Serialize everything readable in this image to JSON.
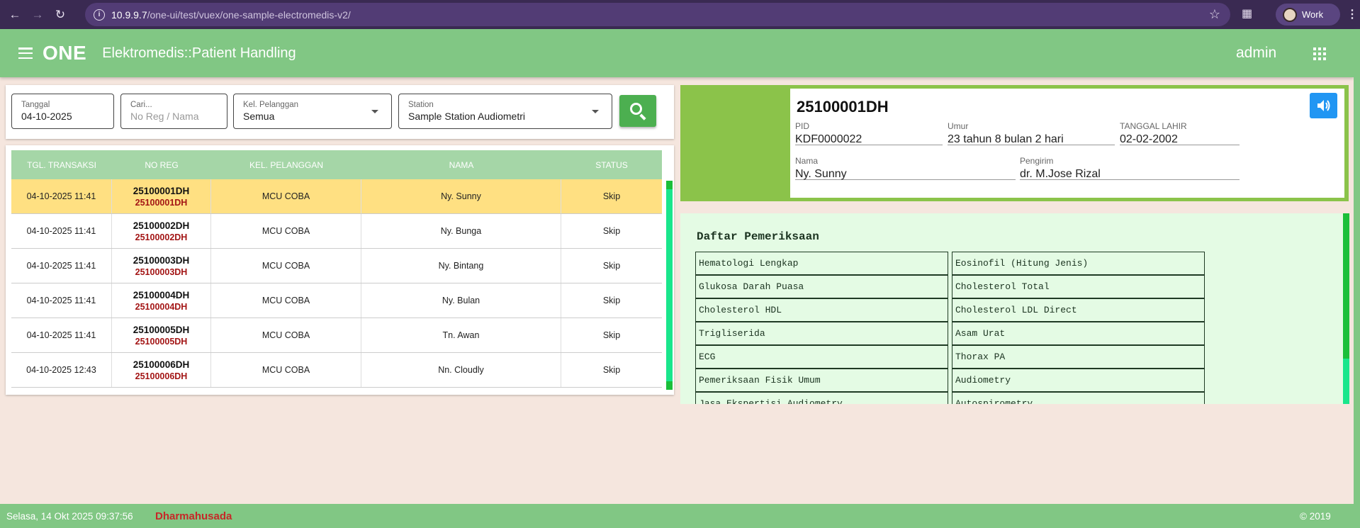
{
  "browser": {
    "url_host": "10.9.9.7",
    "url_path": "/one-ui/test/vuex/one-sample-electromedis-v2/",
    "profile_label": "Work"
  },
  "header": {
    "brand": "ONE",
    "title": "Elektromedis::Patient Handling",
    "user": "admin"
  },
  "filters": {
    "tanggal": {
      "label": "Tanggal",
      "value": "04-10-2025"
    },
    "cari": {
      "label": "Cari...",
      "placeholder": "No Reg / Nama"
    },
    "kel_pelanggan": {
      "label": "Kel. Pelanggan",
      "value": "Semua"
    },
    "station": {
      "label": "Station",
      "value": "Sample Station Audiometri"
    }
  },
  "table": {
    "headers": [
      "TGL. TRANSAKSI",
      "NO REG",
      "KEL. PELANGGAN",
      "NAMA",
      "STATUS"
    ],
    "rows": [
      {
        "tgl": "04-10-2025 11:41",
        "noreg": "25100001DH",
        "noreg2": "25100001DH",
        "kel": "MCU COBA",
        "nama": "Ny. Sunny",
        "status": "Skip"
      },
      {
        "tgl": "04-10-2025 11:41",
        "noreg": "25100002DH",
        "noreg2": "25100002DH",
        "kel": "MCU COBA",
        "nama": "Ny. Bunga",
        "status": "Skip"
      },
      {
        "tgl": "04-10-2025 11:41",
        "noreg": "25100003DH",
        "noreg2": "25100003DH",
        "kel": "MCU COBA",
        "nama": "Ny. Bintang",
        "status": "Skip"
      },
      {
        "tgl": "04-10-2025 11:41",
        "noreg": "25100004DH",
        "noreg2": "25100004DH",
        "kel": "MCU COBA",
        "nama": "Ny. Bulan",
        "status": "Skip"
      },
      {
        "tgl": "04-10-2025 11:41",
        "noreg": "25100005DH",
        "noreg2": "25100005DH",
        "kel": "MCU COBA",
        "nama": "Tn. Awan",
        "status": "Skip"
      },
      {
        "tgl": "04-10-2025 12:43",
        "noreg": "25100006DH",
        "noreg2": "25100006DH",
        "kel": "MCU COBA",
        "nama": "Nn. Cloudly",
        "status": "Skip"
      }
    ]
  },
  "patient": {
    "noreg": "25100001DH",
    "pid_label": "PID",
    "pid": "KDF0000022",
    "umur_label": "Umur",
    "umur": "23 tahun 8 bulan 2 hari",
    "lahir_label": "TANGGAL LAHIR",
    "lahir": "02-02-2002",
    "nama_label": "Nama",
    "nama": "Ny. Sunny",
    "pengirim_label": "Pengirim",
    "pengirim": "dr. M.Jose Rizal"
  },
  "exams": {
    "title": "Daftar Pemeriksaan",
    "items": [
      "Hematologi Lengkap",
      "Eosinofil (Hitung Jenis)",
      "Glukosa Darah Puasa",
      "Cholesterol Total",
      "Cholesterol HDL",
      "Cholesterol LDL Direct",
      "Trigliserida",
      "Asam Urat",
      "ECG",
      "Thorax PA",
      "Pemeriksaan Fisik Umum",
      "Audiometry",
      "Jasa Ekspertisi Audiometry",
      "Autospirometry"
    ]
  },
  "footer": {
    "datetime": "Selasa, 14 Okt 2025 09:37:56",
    "org": "Dharmahusada",
    "copyright": "© 2019"
  },
  "colors": {
    "appbar": "#81c784",
    "selected_row": "#ffe082",
    "patient_card": "#8bc34a",
    "noreg_red": "#a31515"
  }
}
